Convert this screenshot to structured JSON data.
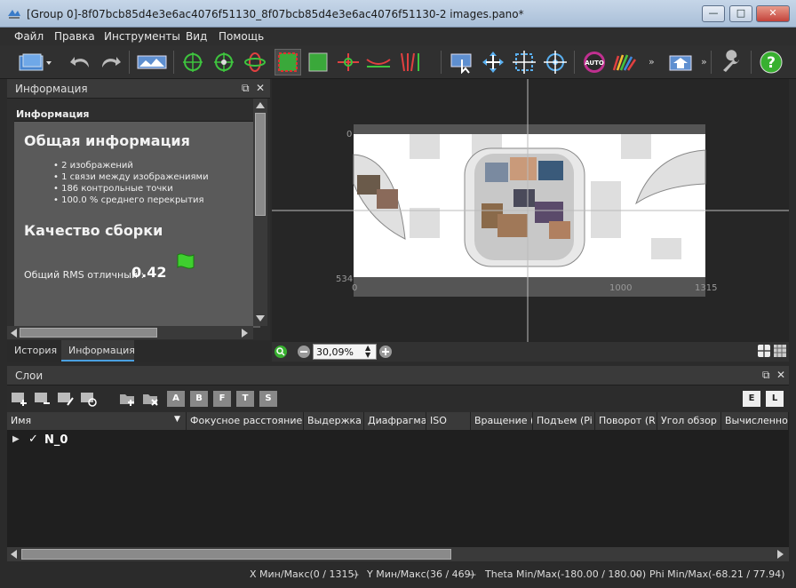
{
  "window": {
    "title": "[Group 0]-8f07bcb85d4e3e6ac4076f51130_8f07bcb85d4e3e6ac4076f51130-2 images.pano*",
    "min_label": "—",
    "max_label": "□",
    "close_label": "✕"
  },
  "menu": [
    "Файл",
    "Правка",
    "Инструменты",
    "Вид",
    "Помощь"
  ],
  "toolbar": {
    "more_1": "»",
    "more_2": "»",
    "auto_label": "AUTO",
    "help_label": "?"
  },
  "info_panel": {
    "header": "Информация",
    "subheader": "Информация",
    "general_title": "Общая информация",
    "bullets": [
      "• 2 изображений",
      "• 1 связи между изображениями",
      "• 186 контрольные точки",
      "• 100.0 % среднего перекрытия"
    ],
    "quality_title": "Качество сборки",
    "rms_label": "Общий RMS отличный :",
    "rms_value": "0.42",
    "tabs": [
      "История",
      "Информация"
    ]
  },
  "viewer": {
    "axis_top_left": "0",
    "axis_left_bottom": "534",
    "axis_x": [
      "0",
      "1000",
      "1315"
    ]
  },
  "zoom": {
    "value": "30,09%"
  },
  "layers": {
    "header": "Слои",
    "right_buttons": [
      "E",
      "L"
    ],
    "icon_buttons_labels": [
      "A",
      "B",
      "F",
      "T",
      "S"
    ],
    "columns": [
      "Имя",
      "Фокусное расстояние",
      "Выдержка",
      "Диафрагма",
      "ISO",
      "Вращение (",
      "Подъем (Pi",
      "Поворот (R",
      "Угол обзор",
      "Вычисленное"
    ],
    "rows": [
      {
        "name": "N_0",
        "checked": "✓",
        "expander": "▶"
      }
    ]
  },
  "status": {
    "x": "X Мин/Макс(0 / 1315)",
    "sep1": "--",
    "y": "Y Мин/Макс(36 / 469)",
    "sep2": "--",
    "theta": "Theta Min/Max(-180.00 / 180.00)",
    "sep3": "--",
    "phi": "Phi Min/Max(-68.21 / 77.94)"
  },
  "colors": {
    "accent": "#4aa0e0",
    "flag": "#3fcf2f",
    "panel_bg": "#5a5a5a"
  }
}
